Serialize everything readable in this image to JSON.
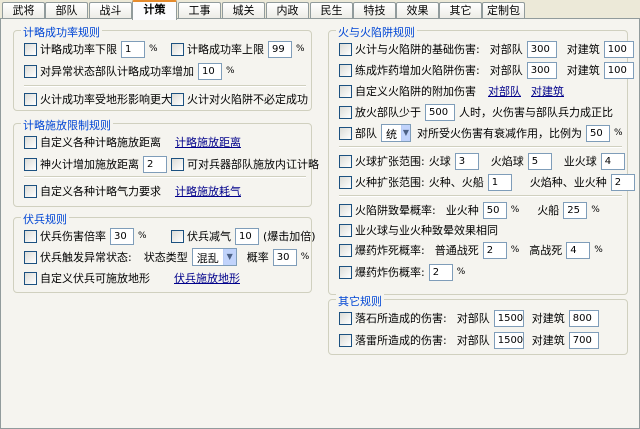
{
  "tabs": [
    "武将",
    "部队",
    "战斗",
    "计策",
    "工事",
    "城关",
    "内政",
    "民生",
    "特技",
    "效果",
    "其它",
    "定制包"
  ],
  "active_tab": "计策",
  "success": {
    "title": "计略成功率规则",
    "min_label": "计略成功率下限",
    "min_value": "1",
    "max_label": "计略成功率上限",
    "max_value": "99",
    "abnormal_label": "对异常状态部队计略成功率增加",
    "abnormal_value": "10",
    "terrain_label": "火计成功率受地形影响更大",
    "trap_label": "火计对火陷阱不必定成功",
    "pct": "%"
  },
  "cast": {
    "title": "计略施放限制规则",
    "custom_dist_label": "自定义各种计略施放距离",
    "custom_dist_link": "计略施放距离",
    "shenhuo_label": "神火计增加施放距离",
    "shenhuo_value": "2",
    "weapon_label": "可对兵器部队施放内讧计略",
    "energy_label": "自定义各种计略气力要求",
    "energy_link": "计略施放耗气"
  },
  "ambush": {
    "title": "伏兵规则",
    "dmg_label": "伏兵伤害倍率",
    "dmg_value": "30",
    "morale_label": "伏兵减气",
    "morale_value": "10",
    "morale_note": "(爆击加倍)",
    "status_label": "伏兵触发异常状态:",
    "type_label": "状态类型",
    "type_value": "混乱",
    "prob_label": "概率",
    "prob_value": "30",
    "terrain_label": "自定义伏兵可施放地形",
    "terrain_link": "伏兵施放地形",
    "pct": "%"
  },
  "fire": {
    "title": "火与火陷阱规则",
    "base_label": "火计与火陷阱的基础伤害:",
    "explosive_label": "练成炸药增加火陷阱伤害:",
    "vs_unit": "对部队",
    "vs_building": "对建筑",
    "base_unit": "300",
    "base_building": "100",
    "exp_unit": "300",
    "exp_building": "100",
    "custom_label": "自定义火陷阱的附加伤害",
    "custom_link_unit": "对部队",
    "custom_link_building": "对建筑",
    "few_label": "放火部队少于",
    "few_value": "500",
    "few_suffix": "人时，火伤害与部队兵力成正比",
    "unit_label": "部队",
    "stat_value": "统",
    "reduce_label": "对所受火伤害有衰减作用，比例为",
    "reduce_value": "50",
    "ball_label": "火球扩张范围:",
    "ball1": "火球",
    "ball1_v": "3",
    "ball2": "火焰球",
    "ball2_v": "5",
    "ball3": "业火球",
    "ball3_v": "4",
    "seed_label": "火种扩张范围:",
    "seed1": "火种、火船",
    "seed1_v": "1",
    "seed2": "火焰种、业火种",
    "seed2_v": "2",
    "trap_label": "火陷阱致晕概率:",
    "trap1": "业火种",
    "trap1_v": "50",
    "trap2": "火船",
    "trap2_v": "25",
    "same_label": "业火球与业火种致晕效果相同",
    "kill_label": "爆药炸死概率:",
    "kill1": "普通战死",
    "kill1_v": "2",
    "kill2": "高战死",
    "kill2_v": "4",
    "hurt_label": "爆药炸伤概率:",
    "hurt_v": "2",
    "pct": "%"
  },
  "other": {
    "title": "其它规则",
    "rock_label": "落石所造成的伤害:",
    "thunder_label": "落雷所造成的伤害:",
    "vs_unit": "对部队",
    "vs_building": "对建筑",
    "rock_unit": "1500",
    "rock_building": "800",
    "thunder_unit": "1500",
    "thunder_building": "700"
  }
}
